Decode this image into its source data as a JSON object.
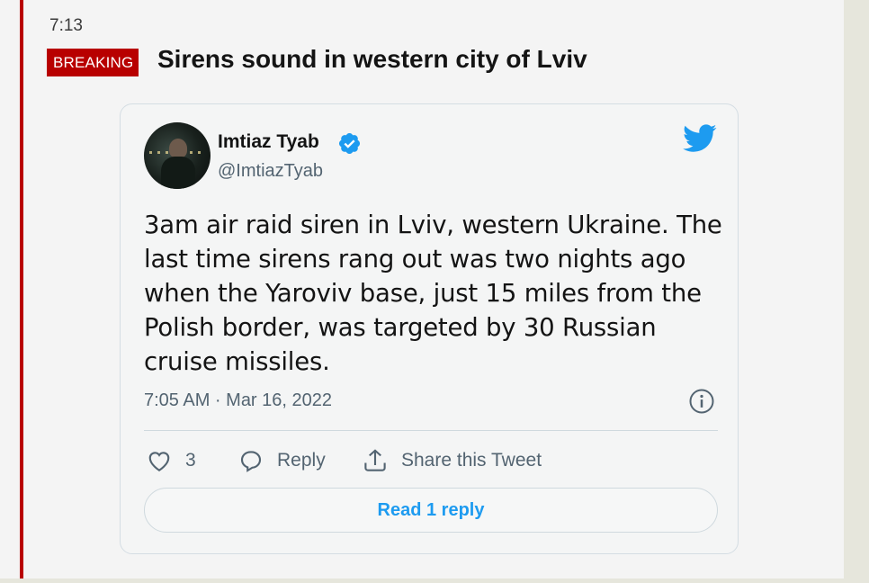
{
  "entry": {
    "time": "7:13",
    "badge": "BREAKING",
    "headline": "Sirens sound in western city of Lviv"
  },
  "tweet": {
    "author_name": "Imtiaz Tyab",
    "handle": "@ImtiazTyab",
    "verified": true,
    "text": "3am air raid siren in Lviv, western Ukraine. The last time sirens rang out was two nights ago when the Yaroviv base, just 15 miles from the Polish border, was targeted by 30 Russian cruise missiles.",
    "timestamp": "7:05 AM · Mar 16, 2022",
    "like_count": "3",
    "reply_label": "Reply",
    "share_label": "Share this Tweet",
    "read_replies_label": "Read 1 reply",
    "icons": [
      "verified-icon",
      "twitter-bird-icon",
      "info-icon",
      "heart-icon",
      "reply-bubble-icon",
      "share-icon"
    ]
  },
  "colors": {
    "breaking_red": "#b80000",
    "twitter_blue": "#1d9bf0",
    "muted_text": "#536471"
  }
}
